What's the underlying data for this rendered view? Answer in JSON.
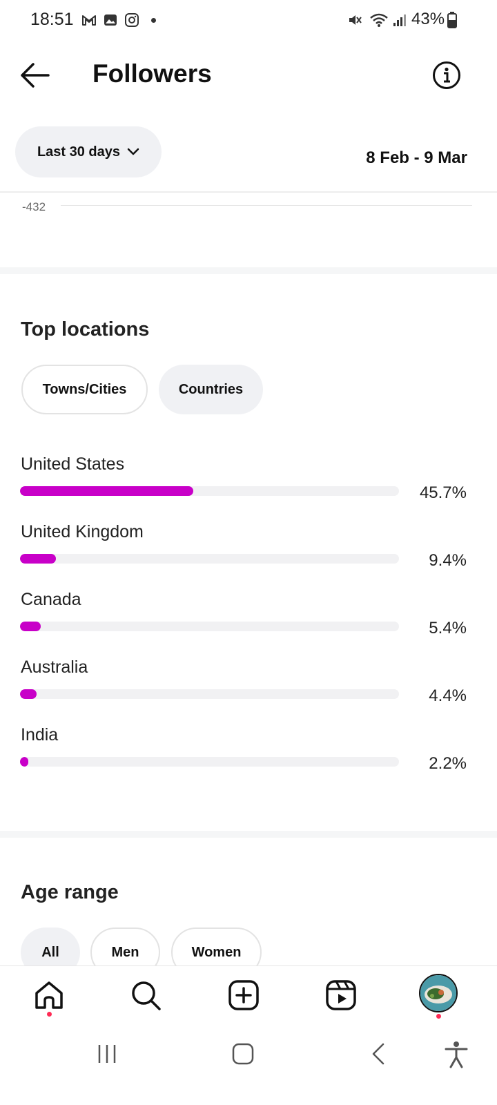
{
  "status_bar": {
    "time": "18:51",
    "battery": "43%",
    "icons": [
      "gmail-icon",
      "gallery-icon",
      "instagram-icon",
      "notification-dot-icon",
      "mute-icon",
      "wifi-icon",
      "signal-icon",
      "battery-icon"
    ]
  },
  "header": {
    "title": "Followers",
    "back_icon": "arrow-left-icon",
    "info_icon": "info-icon"
  },
  "filters": {
    "range_label": "Last 30 days",
    "date_range": "8 Feb - 9 Mar"
  },
  "chart_tail": {
    "tick_label": "-432"
  },
  "top_locations": {
    "heading": "Top locations",
    "tabs": [
      {
        "label": "Towns/Cities",
        "selected": false
      },
      {
        "label": "Countries",
        "selected": true
      }
    ],
    "items": [
      {
        "name": "United States",
        "percent_label": "45.7%",
        "percent": 45.7
      },
      {
        "name": "United Kingdom",
        "percent_label": "9.4%",
        "percent": 9.4
      },
      {
        "name": "Canada",
        "percent_label": "5.4%",
        "percent": 5.4
      },
      {
        "name": "Australia",
        "percent_label": "4.4%",
        "percent": 4.4
      },
      {
        "name": "India",
        "percent_label": "2.2%",
        "percent": 2.2
      }
    ],
    "bar_color": "#c800c8"
  },
  "age_range": {
    "heading": "Age range",
    "tabs": [
      {
        "label": "All",
        "selected": true
      },
      {
        "label": "Men",
        "selected": false
      },
      {
        "label": "Women",
        "selected": false
      }
    ]
  },
  "bottom_nav": {
    "items": [
      "home-icon",
      "search-icon",
      "create-icon",
      "reels-icon",
      "profile-avatar"
    ]
  },
  "system_nav": {
    "items": [
      "recent-apps-icon",
      "home-button-icon",
      "back-button-icon",
      "accessibility-icon"
    ]
  }
}
